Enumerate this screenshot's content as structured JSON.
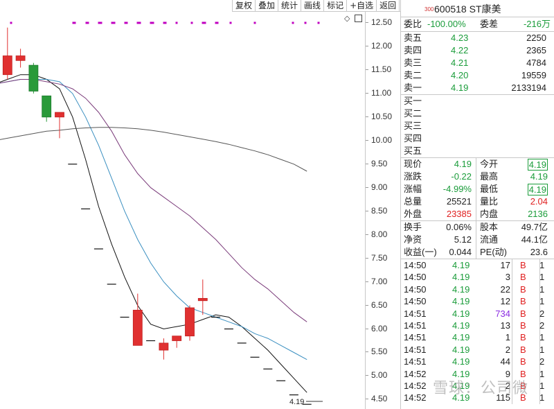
{
  "toolbar": {
    "items": [
      "复权",
      "叠加",
      "统计",
      "画线",
      "标记",
      "+自选",
      "返回"
    ]
  },
  "security": {
    "market_code": "300",
    "code": "600518",
    "name": "ST康美"
  },
  "axis_ticks": [
    "12.50",
    "12.00",
    "11.50",
    "11.00",
    "10.50",
    "10.00",
    "9.50",
    "9.00",
    "8.50",
    "8.00",
    "7.50",
    "7.00",
    "6.50",
    "6.00",
    "5.50",
    "5.00",
    "4.50"
  ],
  "last_price_label": "4.19",
  "chart_data": {
    "type": "candlestick",
    "ylim": [
      4.3,
      12.75
    ],
    "candles": [
      {
        "o": 11.25,
        "h": 11.4,
        "l": 11.1,
        "c": 11.2
      },
      {
        "o": 11.4,
        "h": 12.4,
        "l": 11.3,
        "c": 11.8
      },
      {
        "o": 11.7,
        "h": 11.95,
        "l": 11.55,
        "c": 11.8
      },
      {
        "o": 11.6,
        "h": 11.65,
        "l": 11.0,
        "c": 11.05
      },
      {
        "o": 10.95,
        "h": 10.95,
        "l": 10.4,
        "c": 10.5
      },
      {
        "o": 10.5,
        "h": 10.6,
        "l": 10.05,
        "c": 10.6
      },
      {
        "o": 9.5,
        "h": 9.5,
        "l": 9.5,
        "c": 9.5
      },
      {
        "o": 8.55,
        "h": 8.55,
        "l": 8.55,
        "c": 8.55
      },
      {
        "o": 7.7,
        "h": 7.7,
        "l": 7.7,
        "c": 7.7
      },
      {
        "o": 6.95,
        "h": 6.95,
        "l": 6.95,
        "c": 6.95
      },
      {
        "o": 6.25,
        "h": 6.25,
        "l": 6.25,
        "c": 6.25
      },
      {
        "o": 5.65,
        "h": 6.75,
        "l": 5.65,
        "c": 6.4
      },
      {
        "o": 5.75,
        "h": 5.75,
        "l": 5.75,
        "c": 5.75
      },
      {
        "o": 5.55,
        "h": 5.8,
        "l": 5.35,
        "c": 5.7
      },
      {
        "o": 5.75,
        "h": 5.85,
        "l": 5.6,
        "c": 5.85
      },
      {
        "o": 5.85,
        "h": 6.5,
        "l": 5.75,
        "c": 6.45
      },
      {
        "o": 6.6,
        "h": 7.05,
        "l": 6.3,
        "c": 6.65
      },
      {
        "o": 6.25,
        "h": 6.25,
        "l": 6.25,
        "c": 6.25
      },
      {
        "o": 6.0,
        "h": 6.0,
        "l": 6.0,
        "c": 6.0
      },
      {
        "o": 5.7,
        "h": 5.7,
        "l": 5.7,
        "c": 5.7
      },
      {
        "o": 5.4,
        "h": 5.4,
        "l": 5.4,
        "c": 5.4
      },
      {
        "o": 5.15,
        "h": 5.15,
        "l": 5.15,
        "c": 5.15
      },
      {
        "o": 4.9,
        "h": 4.9,
        "l": 4.9,
        "c": 4.9
      },
      {
        "o": 4.6,
        "h": 4.6,
        "l": 4.6,
        "c": 4.6
      },
      {
        "o": 4.4,
        "h": 4.4,
        "l": 4.4,
        "c": 4.4
      }
    ],
    "series": [
      {
        "color": "#111111",
        "values": [
          11.2,
          11.3,
          11.4,
          11.4,
          11.3,
          11.1,
          10.5,
          9.6,
          8.6,
          7.8,
          7.1,
          6.5,
          6.1,
          6.0,
          6.05,
          6.1,
          6.2,
          6.3,
          6.25,
          6.05,
          5.8,
          5.55,
          5.25,
          4.95,
          4.65
        ]
      },
      {
        "color": "#3a8fc0",
        "values": [
          11.2,
          11.25,
          11.3,
          11.3,
          11.3,
          11.25,
          11.0,
          10.5,
          9.9,
          9.2,
          8.5,
          7.9,
          7.4,
          7.0,
          6.7,
          6.45,
          6.35,
          6.25,
          6.15,
          6.05,
          5.9,
          5.8,
          5.65,
          5.5,
          5.35
        ]
      },
      {
        "color": "#7a3b7a",
        "values": [
          11.2,
          11.25,
          11.3,
          11.3,
          11.25,
          11.2,
          11.1,
          10.9,
          10.6,
          10.2,
          9.7,
          9.3,
          9.0,
          8.8,
          8.6,
          8.4,
          8.15,
          7.9,
          7.6,
          7.3,
          7.05,
          6.85,
          6.6,
          6.35,
          6.15
        ]
      },
      {
        "color": "#555555",
        "values": [
          10.0,
          10.05,
          10.1,
          10.15,
          10.2,
          10.22,
          10.25,
          10.27,
          10.28,
          10.28,
          10.27,
          10.25,
          10.22,
          10.18,
          10.13,
          10.08,
          10.03,
          9.98,
          9.92,
          9.85,
          9.78,
          9.7,
          9.6,
          9.5,
          9.35
        ]
      }
    ],
    "markers": {
      "count": 12,
      "y": 12.5,
      "color": "#c000c0"
    }
  },
  "panel": {
    "weibi": {
      "label": "委比",
      "value": "-100.00%",
      "label2": "委差",
      "value2": "-216万"
    },
    "asks": [
      {
        "label": "卖五",
        "price": "4.23",
        "vol": "2250"
      },
      {
        "label": "卖四",
        "price": "4.22",
        "vol": "2365"
      },
      {
        "label": "卖三",
        "price": "4.21",
        "vol": "4784"
      },
      {
        "label": "卖二",
        "price": "4.20",
        "vol": "19559"
      },
      {
        "label": "卖一",
        "price": "4.19",
        "vol": "2133194"
      }
    ],
    "bids": [
      {
        "label": "买一"
      },
      {
        "label": "买二"
      },
      {
        "label": "买三"
      },
      {
        "label": "买四"
      },
      {
        "label": "买五"
      }
    ],
    "quote": [
      {
        "l1": "现价",
        "v1": "4.19",
        "c1": "g",
        "l2": "今开",
        "v2": "4.19",
        "c2": "g",
        "box": "g"
      },
      {
        "l1": "涨跌",
        "v1": "-0.22",
        "c1": "g",
        "l2": "最高",
        "v2": "4.19",
        "c2": "g",
        "box": ""
      },
      {
        "l1": "涨幅",
        "v1": "-4.99%",
        "c1": "g",
        "l2": "最低",
        "v2": "4.19",
        "c2": "g",
        "box": "g"
      },
      {
        "l1": "总量",
        "v1": "25521",
        "c1": "k",
        "l2": "量比",
        "v2": "2.04",
        "c2": "r",
        "box": ""
      },
      {
        "l1": "外盘",
        "v1": "23385",
        "c1": "r",
        "l2": "内盘",
        "v2": "2136",
        "c2": "g",
        "box": ""
      }
    ],
    "fund": [
      {
        "l1": "换手",
        "v1": "0.06%",
        "l2": "股本",
        "v2": "49.7亿"
      },
      {
        "l1": "净资",
        "v1": "5.12",
        "l2": "流通",
        "v2": "44.1亿"
      },
      {
        "l1": "收益(一)",
        "v1": "0.044",
        "l2": "PE(动)",
        "v2": "23.6"
      }
    ],
    "ticks": [
      {
        "t": "14:50",
        "p": "4.19",
        "v": "17",
        "vc": "k",
        "s": "B",
        "n": "1"
      },
      {
        "t": "14:50",
        "p": "4.19",
        "v": "3",
        "vc": "k",
        "s": "B",
        "n": "1"
      },
      {
        "t": "14:50",
        "p": "4.19",
        "v": "22",
        "vc": "k",
        "s": "B",
        "n": "1"
      },
      {
        "t": "14:50",
        "p": "4.19",
        "v": "12",
        "vc": "k",
        "s": "B",
        "n": "1"
      },
      {
        "t": "14:51",
        "p": "4.19",
        "v": "734",
        "vc": "p",
        "s": "B",
        "n": "2"
      },
      {
        "t": "14:51",
        "p": "4.19",
        "v": "13",
        "vc": "k",
        "s": "B",
        "n": "2"
      },
      {
        "t": "14:51",
        "p": "4.19",
        "v": "1",
        "vc": "k",
        "s": "B",
        "n": "1"
      },
      {
        "t": "14:51",
        "p": "4.19",
        "v": "2",
        "vc": "k",
        "s": "B",
        "n": "1"
      },
      {
        "t": "14:51",
        "p": "4.19",
        "v": "44",
        "vc": "k",
        "s": "B",
        "n": "2"
      },
      {
        "t": "14:52",
        "p": "4.19",
        "v": "9",
        "vc": "k",
        "s": "B",
        "n": "1"
      },
      {
        "t": "14:52",
        "p": "4.19",
        "v": "2",
        "vc": "k",
        "s": "B",
        "n": "1"
      },
      {
        "t": "14:52",
        "p": "4.19",
        "v": "115",
        "vc": "k",
        "s": "B",
        "n": "1"
      }
    ]
  },
  "watermark": "雪球：公司微"
}
